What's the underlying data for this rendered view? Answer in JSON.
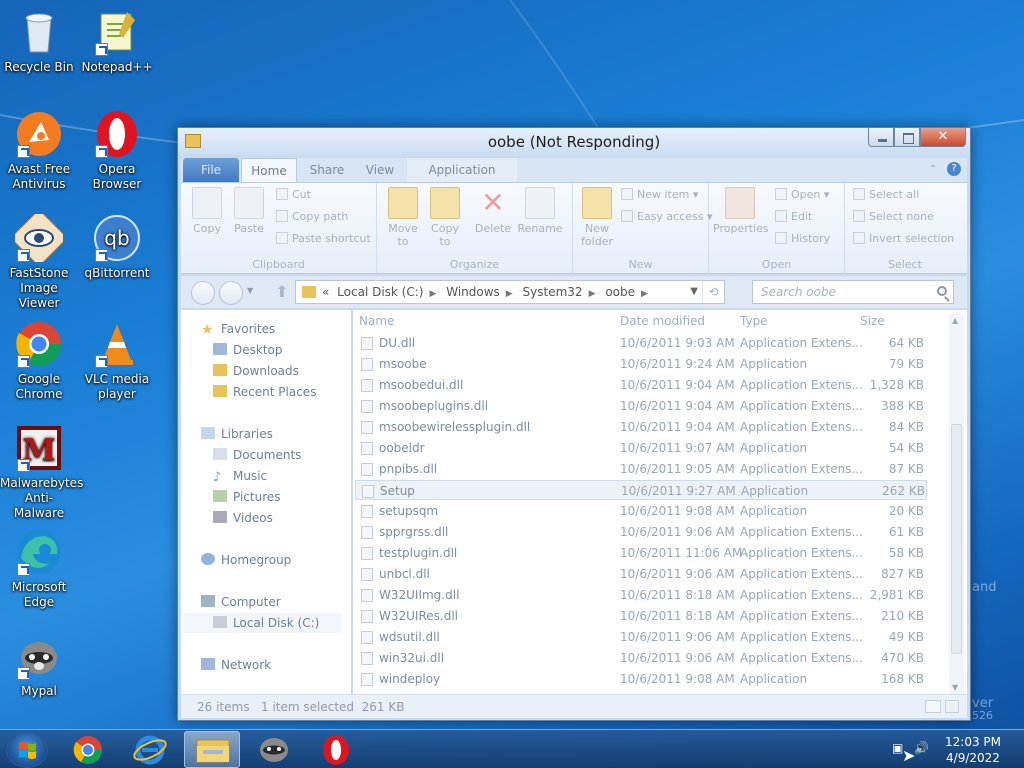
{
  "desktop": {
    "icons": [
      {
        "label": "Recycle Bin",
        "icon": "recycle-bin-icon"
      },
      {
        "label": "Notepad++",
        "icon": "notepadpp-icon"
      },
      {
        "label": "Avast Free Antivirus",
        "icon": "avast-icon"
      },
      {
        "label": "Opera Browser",
        "icon": "opera-icon"
      },
      {
        "label": "FastStone Image Viewer",
        "icon": "faststone-icon"
      },
      {
        "label": "qBittorrent",
        "icon": "qbittorrent-icon"
      },
      {
        "label": "Google Chrome",
        "icon": "chrome-icon"
      },
      {
        "label": "VLC media player",
        "icon": "vlc-icon"
      },
      {
        "label": "Malwarebytes Anti-Malware",
        "icon": "malwarebytes-icon"
      },
      {
        "label": "Microsoft Edge",
        "icon": "edge-icon"
      },
      {
        "label": "Mypal",
        "icon": "mypal-icon"
      }
    ],
    "watermark": [
      "and",
      "ver",
      "526"
    ]
  },
  "window": {
    "title": "oobe (Not Responding)",
    "tabs": [
      "File",
      "Home",
      "Share",
      "View",
      "Application"
    ],
    "ribbon": {
      "clipboard": {
        "label": "Clipboard",
        "copy": "Copy",
        "paste": "Paste",
        "cut": "Cut",
        "copy_path": "Copy path",
        "paste_shortcut": "Paste shortcut"
      },
      "organize": {
        "label": "Organize",
        "move_to": "Move to",
        "copy_to": "Copy to",
        "delete": "Delete",
        "rename": "Rename"
      },
      "new": {
        "label": "New",
        "new_folder": "New folder",
        "new_item": "New item",
        "easy_access": "Easy access"
      },
      "open": {
        "label": "Open",
        "properties": "Properties",
        "open": "Open",
        "edit": "Edit",
        "history": "History"
      },
      "select": {
        "label": "Select",
        "select_all": "Select all",
        "select_none": "Select none",
        "invert": "Invert selection"
      }
    },
    "address": {
      "prefix": "«",
      "crumbs": [
        "Local Disk (C:)",
        "Windows",
        "System32",
        "oobe"
      ],
      "search_placeholder": "Search oobe"
    },
    "nav": {
      "favorites": "Favorites",
      "desktop": "Desktop",
      "downloads": "Downloads",
      "recent": "Recent Places",
      "libraries": "Libraries",
      "documents": "Documents",
      "music": "Music",
      "pictures": "Pictures",
      "videos": "Videos",
      "homegroup": "Homegroup",
      "computer": "Computer",
      "local_disk": "Local Disk (C:)",
      "network": "Network"
    },
    "columns": {
      "name": "Name",
      "date": "Date modified",
      "type": "Type",
      "size": "Size"
    },
    "files": [
      {
        "name": "DU.dll",
        "date": "10/6/2011 9:03 AM",
        "type": "Application Extens...",
        "size": "64 KB"
      },
      {
        "name": "msoobe",
        "date": "10/6/2011 9:24 AM",
        "type": "Application",
        "size": "79 KB"
      },
      {
        "name": "msoobedui.dll",
        "date": "10/6/2011 9:04 AM",
        "type": "Application Extens...",
        "size": "1,328 KB"
      },
      {
        "name": "msoobeplugins.dll",
        "date": "10/6/2011 9:04 AM",
        "type": "Application Extens...",
        "size": "388 KB"
      },
      {
        "name": "msoobewirelessplugin.dll",
        "date": "10/6/2011 9:04 AM",
        "type": "Application Extens...",
        "size": "84 KB"
      },
      {
        "name": "oobeldr",
        "date": "10/6/2011 9:07 AM",
        "type": "Application",
        "size": "54 KB"
      },
      {
        "name": "pnpibs.dll",
        "date": "10/6/2011 9:05 AM",
        "type": "Application Extens...",
        "size": "87 KB"
      },
      {
        "name": "Setup",
        "date": "10/6/2011 9:27 AM",
        "type": "Application",
        "size": "262 KB"
      },
      {
        "name": "setupsqm",
        "date": "10/6/2011 9:08 AM",
        "type": "Application",
        "size": "20 KB"
      },
      {
        "name": "spprgrss.dll",
        "date": "10/6/2011 9:06 AM",
        "type": "Application Extens...",
        "size": "61 KB"
      },
      {
        "name": "testplugin.dll",
        "date": "10/6/2011 11:06 AM",
        "type": "Application Extens...",
        "size": "58 KB"
      },
      {
        "name": "unbcl.dll",
        "date": "10/6/2011 9:06 AM",
        "type": "Application Extens...",
        "size": "827 KB"
      },
      {
        "name": "W32UIImg.dll",
        "date": "10/6/2011 8:18 AM",
        "type": "Application Extens...",
        "size": "2,981 KB"
      },
      {
        "name": "W32UIRes.dll",
        "date": "10/6/2011 8:18 AM",
        "type": "Application Extens...",
        "size": "210 KB"
      },
      {
        "name": "wdsutil.dll",
        "date": "10/6/2011 9:06 AM",
        "type": "Application Extens...",
        "size": "49 KB"
      },
      {
        "name": "win32ui.dll",
        "date": "10/6/2011 9:06 AM",
        "type": "Application Extens...",
        "size": "470 KB"
      },
      {
        "name": "windeploy",
        "date": "10/6/2011 9:08 AM",
        "type": "Application",
        "size": "168 KB"
      }
    ],
    "selected_index": 7,
    "status": {
      "items": "26 items",
      "selected": "1 item selected  261 KB"
    }
  },
  "taskbar": {
    "time": "12:03 PM",
    "date": "4/9/2022"
  }
}
